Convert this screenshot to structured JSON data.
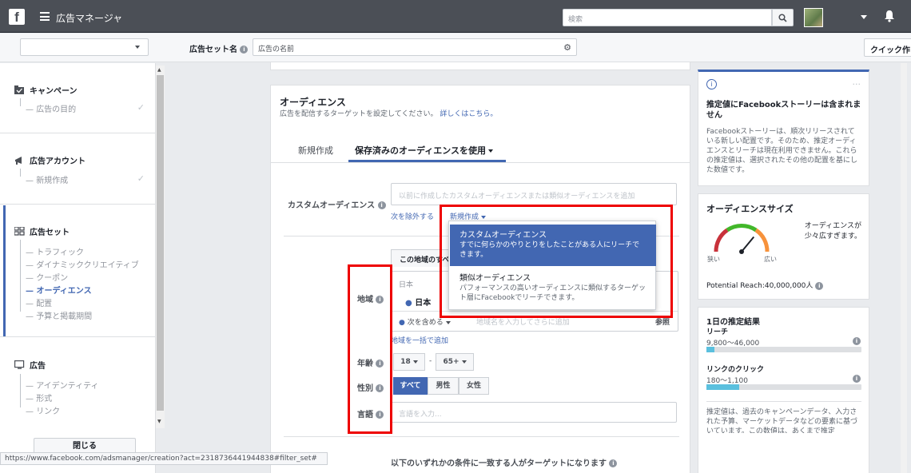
{
  "topbar": {
    "logo": "f",
    "app_title": "広告マネージャ",
    "search_placeholder": "検索"
  },
  "subbar": {
    "adset_label": "広告セット名",
    "adset_name": "広告の名前",
    "quick_button": "クイック作"
  },
  "sidebar": {
    "campaign": {
      "title": "キャンペーン",
      "items": [
        "広告の目的"
      ]
    },
    "account": {
      "title": "広告アカウント",
      "items": [
        "新規作成"
      ]
    },
    "adset": {
      "title": "広告セット",
      "items": [
        "トラフィック",
        "ダイナミッククリエイティブ",
        "クーポン",
        "オーディエンス",
        "配置",
        "予算と掲載期間"
      ]
    },
    "ad": {
      "title": "広告",
      "items": [
        "アイデンティティ",
        "形式",
        "リンク"
      ]
    },
    "close_label": "閉じる"
  },
  "status_url": "https://www.facebook.com/adsmanager/creation?act=2318736441944838#filter_set#",
  "audience": {
    "title": "オーディエンス",
    "subtitle": "広告を配信するターゲットを設定してください。",
    "learn_more": "詳しくはこちら。",
    "tabs": [
      "新規作成",
      "保存済みのオーディエンスを使用"
    ],
    "custom_label": "カスタムオーディエンス",
    "custom_placeholder": "以前に作成したカスタムオーディエンスまたは類似オーディエンスを追加",
    "exclude_link": "次を除外する",
    "new_link": "新規作成",
    "region_tab": "この地域のすべ",
    "location_label": "地域",
    "location_country": "日本",
    "location_selected": "日本",
    "include_select": "次を含める",
    "location_placeholder": "地域名を入力してさらに追加",
    "browse": "参照",
    "bulk_link": "地域を一括で追加",
    "age_label": "年齢",
    "age_min": "18",
    "age_dash": "-",
    "age_max": "65+",
    "gender_label": "性別",
    "gender_options": [
      "すべて",
      "男性",
      "女性"
    ],
    "language_label": "言語",
    "language_placeholder": "言語を入力...",
    "detail_heading": "以下のいずれかの条件に一致する人がターゲットになります"
  },
  "dropdown": {
    "items": [
      {
        "title": "カスタムオーディエンス",
        "desc": "すでに何らかのやりとりをしたことがある人にリーチできます。"
      },
      {
        "title": "類似オーディエンス",
        "desc": "パフォーマンスの高いオーディエンスに類似するターゲット層にFacebookでリーチできます。"
      }
    ]
  },
  "right": {
    "notice_title": "推定値にFacebookストーリーは含まれません",
    "notice_body": "Facebookストーリーは、順次リリースされている新しい配置です。そのため、推定オーディエンスとリーチは現在利用できません。これらの推定値は、選択されたその他の配置を基にした数値です。",
    "size_title": "オーディエンスサイズ",
    "size_desc": "オーディエンスが少々広すぎます。",
    "gauge_narrow": "狭い",
    "gauge_wide": "広い",
    "gauge_level": 0.72,
    "potential_reach": "Potential Reach:40,000,000人",
    "daily_title": "1日の推定結果",
    "reach_label": "リーチ",
    "reach_value": "9,800〜46,000",
    "reach_fill": 0.05,
    "clicks_label": "リンクのクリック",
    "clicks_value": "180〜1,100",
    "clicks_fill": 0.21,
    "estimate_note": "推定値は、過去のキャンペーンデータ、入力された予算、マーケットデータなどの要素に基づいています。この数値は、あくまで推定"
  },
  "colors": {
    "brand": "#4267b2",
    "topbar": "#4b4f56",
    "highlight": "#e00000"
  }
}
